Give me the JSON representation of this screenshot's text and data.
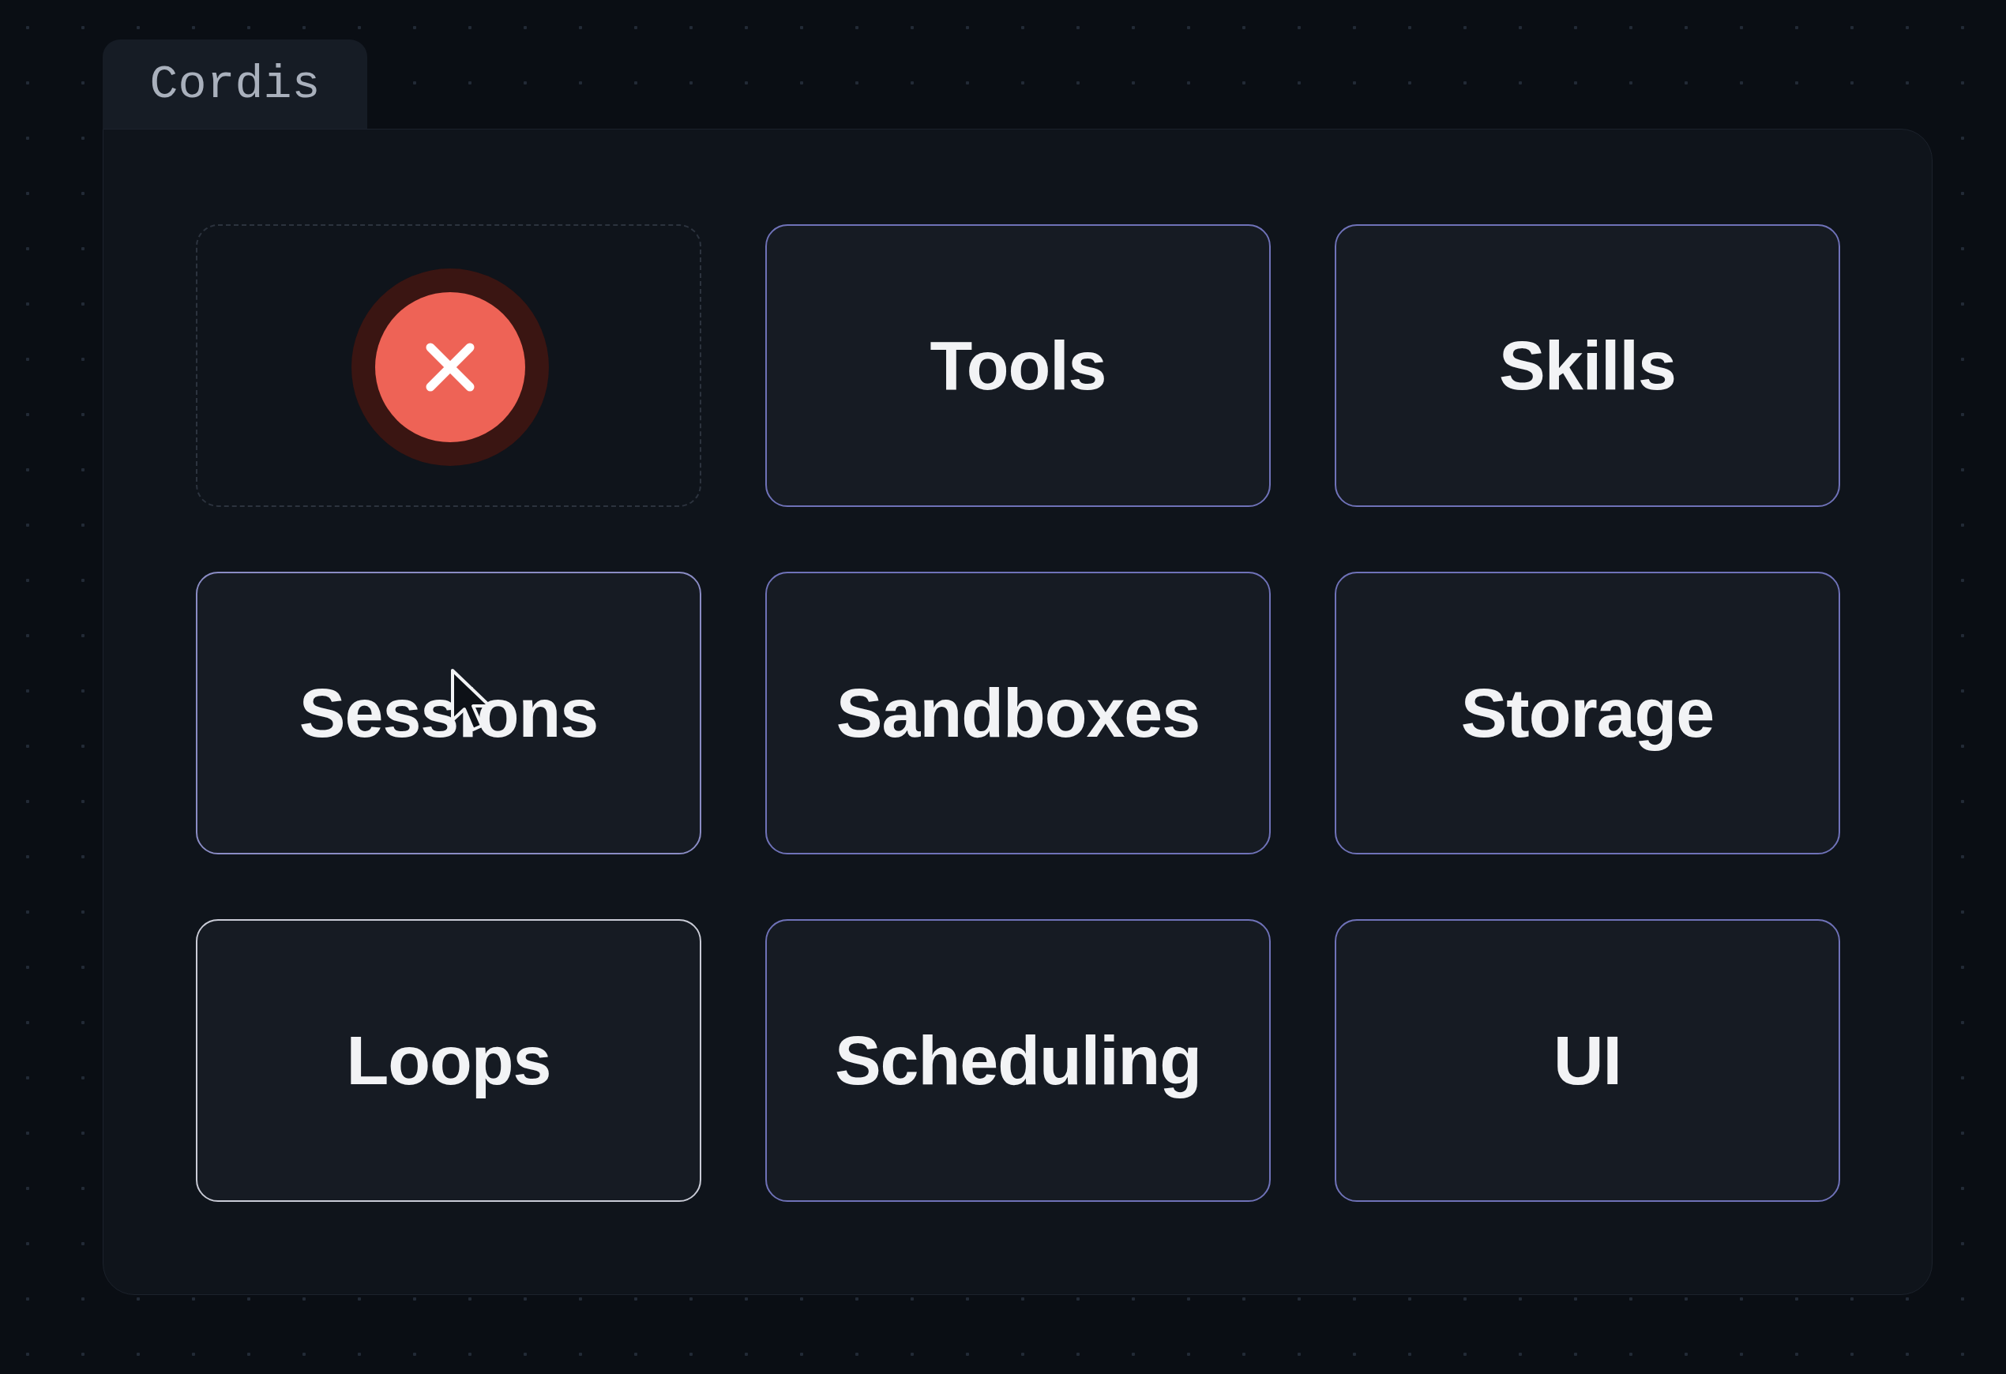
{
  "tab": {
    "label": "Cordis",
    "selected": true
  },
  "cards": [
    {
      "kind": "removed"
    },
    {
      "kind": "card",
      "label": "Tools",
      "color": "#6f72b8"
    },
    {
      "kind": "card",
      "label": "Skills",
      "color": "#6f72b8"
    },
    {
      "kind": "card",
      "label": "Sessions",
      "color": "#8a8cc4",
      "pointer": true
    },
    {
      "kind": "card",
      "label": "Sandboxes",
      "color": "#6f72b8"
    },
    {
      "kind": "card",
      "label": "Storage",
      "color": "#6f72b8"
    },
    {
      "kind": "card",
      "label": "Loops",
      "color": "#c9cbd6"
    },
    {
      "kind": "card",
      "label": "Scheduling",
      "color": "#6f72b8"
    },
    {
      "kind": "card",
      "label": "UI",
      "color": "#6f72b8"
    }
  ]
}
